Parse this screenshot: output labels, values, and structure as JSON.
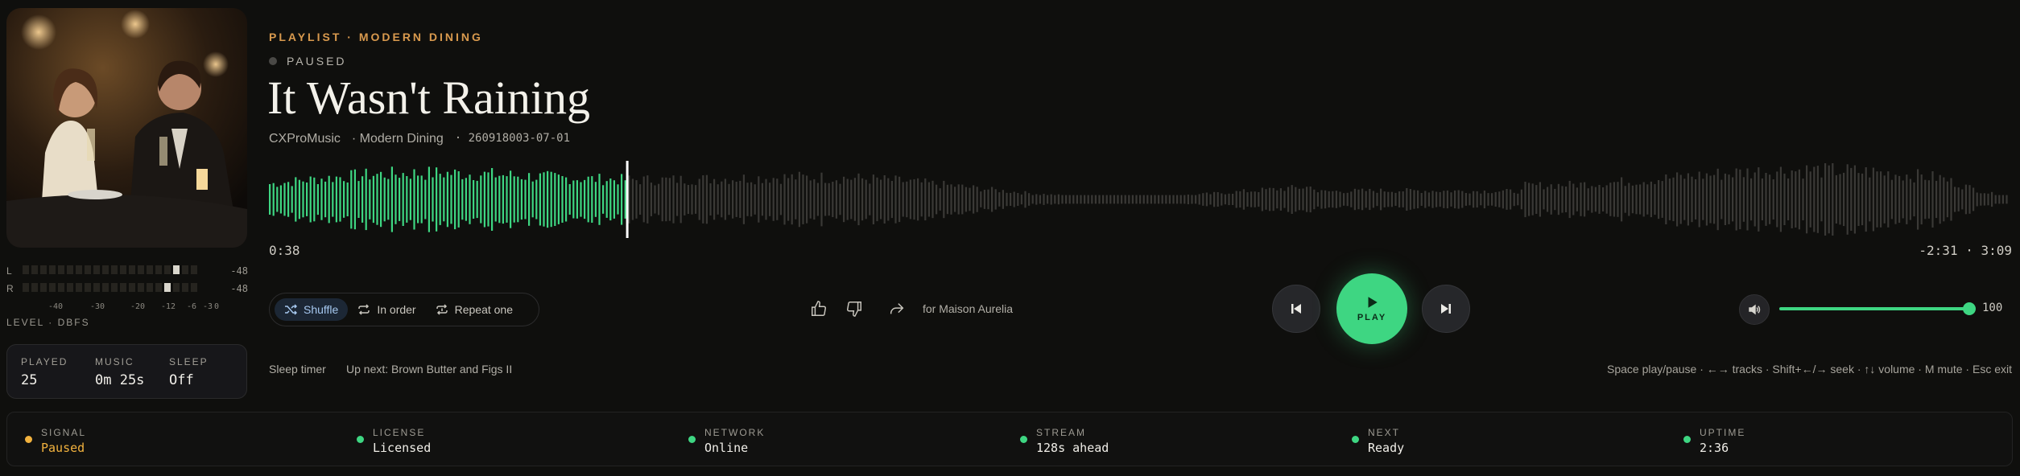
{
  "colors": {
    "accent": "#3ed682",
    "eyebrow": "#d99a4e",
    "warning": "#f2b23e",
    "ok": "#3ed682"
  },
  "album_art": {
    "description_icon": "album-art"
  },
  "meter": {
    "left_label": "L",
    "right_label": "R",
    "left_db": "-48",
    "right_db": "-48",
    "scale": [
      "-40",
      "-30",
      "-20",
      "-12",
      "-6",
      "-3",
      "0"
    ],
    "caption": "LEVEL · DBFS"
  },
  "stats": [
    {
      "key": "PLAYED",
      "value": "25"
    },
    {
      "key": "MUSIC",
      "value": "0m 25s"
    },
    {
      "key": "SLEEP",
      "value": "Off"
    }
  ],
  "header": {
    "eyebrow": "PLAYLIST · MODERN DINING",
    "status": "PAUSED",
    "title": "It Wasn't Raining",
    "artist": "CXProMusic",
    "album": "· Modern Dining",
    "code": "·  260918003-07-01"
  },
  "playback": {
    "elapsed": "0:38",
    "remaining_total": "-2:31 · 3:09",
    "progress_fraction": 0.205
  },
  "modes": [
    {
      "label": "Shuffle",
      "icon": "shuffle-icon",
      "active": true
    },
    {
      "label": "In order",
      "icon": "repeat-icon",
      "active": false
    },
    {
      "label": "Repeat one",
      "icon": "repeat-one-icon",
      "active": false
    }
  ],
  "feedback": {
    "like_icon": "thumbs-up-icon",
    "dislike_icon": "thumbs-down-icon",
    "share_icon": "share-icon",
    "for_label": "for Maison Aurelia"
  },
  "transport": {
    "play_label": "PLAY"
  },
  "volume": {
    "value": "100",
    "level": 1.0
  },
  "footer": {
    "sleep_timer": "Sleep timer",
    "up_next": "Up next: Brown Butter and Figs II",
    "hints": "Space play/pause · ←→ tracks · Shift+←/→ seek · ↑↓ volume · M mute · Esc exit"
  },
  "statusbar": [
    {
      "key": "SIGNAL",
      "value": "Paused",
      "color": "#f2b23e",
      "value_color": "#f2b23e"
    },
    {
      "key": "LICENSE",
      "value": "Licensed",
      "color": "#3ed682",
      "value_color": "#f0eee8"
    },
    {
      "key": "NETWORK",
      "value": "Online",
      "color": "#3ed682",
      "value_color": "#f0eee8"
    },
    {
      "key": "STREAM",
      "value": "128s ahead",
      "color": "#3ed682",
      "value_color": "#f0eee8"
    },
    {
      "key": "NEXT",
      "value": "Ready",
      "color": "#3ed682",
      "value_color": "#f0eee8"
    },
    {
      "key": "UPTIME",
      "value": "2:36",
      "color": "#3ed682",
      "value_color": "#f0eee8"
    }
  ]
}
